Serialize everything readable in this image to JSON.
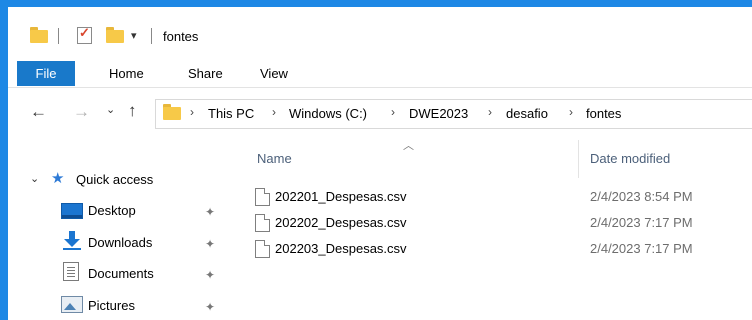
{
  "window": {
    "title": "fontes",
    "accent_color": "#1e88e5",
    "quick_access_toolbar": [
      "folder-icon",
      "properties-check-icon",
      "new-folder-icon",
      "customize-toolbar-icon"
    ]
  },
  "ribbon": {
    "tabs": [
      {
        "label": "File",
        "active": true
      },
      {
        "label": "Home"
      },
      {
        "label": "Share"
      },
      {
        "label": "View"
      }
    ]
  },
  "address_bar": {
    "breadcrumbs": [
      "This PC",
      "Windows (C:)",
      "DWE2023",
      "desafio",
      "fontes"
    ]
  },
  "nav_pane": {
    "quick_access_label": "Quick access",
    "items": [
      {
        "label": "Desktop",
        "icon": "desktop-icon",
        "pinned": true
      },
      {
        "label": "Downloads",
        "icon": "downloads-icon",
        "pinned": true
      },
      {
        "label": "Documents",
        "icon": "documents-icon",
        "pinned": true
      },
      {
        "label": "Pictures",
        "icon": "pictures-icon",
        "pinned": true
      }
    ]
  },
  "file_list": {
    "columns": [
      "Name",
      "Date modified"
    ],
    "rows": [
      {
        "name": "202201_Despesas.csv",
        "date": "2/4/2023 8:54 PM"
      },
      {
        "name": "202202_Despesas.csv",
        "date": "2/4/2023 7:17 PM"
      },
      {
        "name": "202203_Despesas.csv",
        "date": "2/4/2023 7:17 PM"
      }
    ]
  }
}
